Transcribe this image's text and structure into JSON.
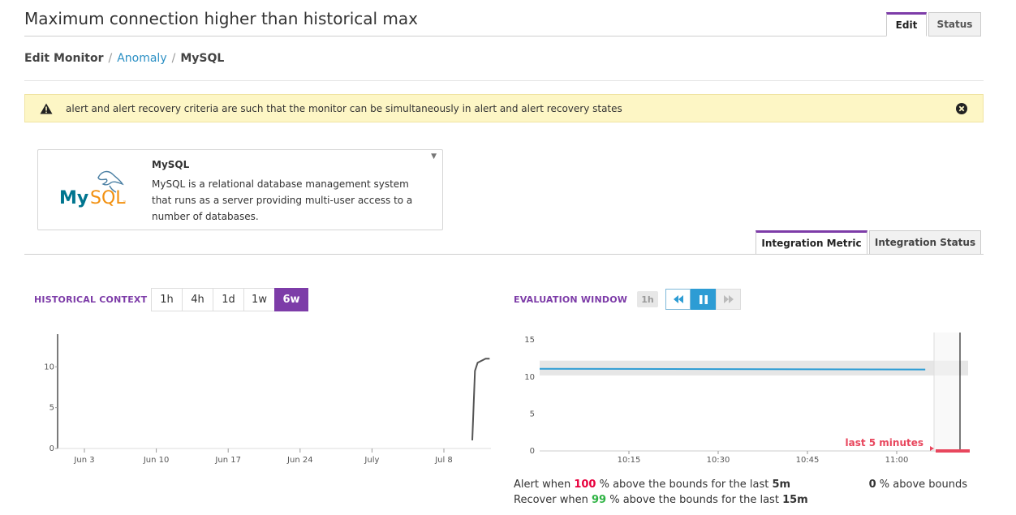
{
  "page": {
    "title": "Maximum connection higher than historical max",
    "tabs": [
      {
        "label": "Edit",
        "active": true
      },
      {
        "label": "Status",
        "active": false
      }
    ]
  },
  "breadcrumb": {
    "root": "Edit Monitor",
    "sep": "/",
    "type": "Anomaly",
    "current": "MySQL"
  },
  "warning": {
    "icon": "warning-icon",
    "text": "alert and alert recovery criteria are such that the monitor can be simultaneously in alert and alert recovery states",
    "close_icon": "close-circle-icon"
  },
  "integration": {
    "logo_text_my": "My",
    "logo_text_sql": "SQL",
    "logo_tm": "™",
    "name": "MySQL",
    "description": "MySQL is a relational database management system that runs as a server providing multi-user access to a number of databases.",
    "tabs": [
      {
        "label": "Integration Metric",
        "active": true
      },
      {
        "label": "Integration Status",
        "active": false
      }
    ]
  },
  "historical": {
    "label": "HISTORICAL CONTEXT",
    "ranges": [
      {
        "label": "1h",
        "active": false
      },
      {
        "label": "4h",
        "active": false
      },
      {
        "label": "1d",
        "active": false
      },
      {
        "label": "1w",
        "active": false
      },
      {
        "label": "6w",
        "active": true
      }
    ]
  },
  "evaluation": {
    "label": "EVALUATION WINDOW",
    "window": "1h",
    "controls": [
      "rewind-icon",
      "pause-icon",
      "fast-forward-icon"
    ]
  },
  "colors": {
    "accent": "#7d3ca8",
    "series": "#2d9cd4",
    "alert": "#e8465d",
    "band": "#e6e6e6"
  },
  "chart_data": [
    {
      "type": "line",
      "name": "historical-context",
      "x_ticks": [
        "Jun 3",
        "Jun 10",
        "Jun 17",
        "Jun 24",
        "July",
        "Jul 8"
      ],
      "y_ticks": [
        0,
        5,
        10
      ],
      "ylim": [
        0,
        14
      ],
      "series": [
        {
          "x": [
            6.22,
            6.26,
            6.3,
            6.42,
            6.48
          ],
          "y": [
            1,
            9.5,
            10.5,
            11,
            11
          ]
        }
      ],
      "grid": false
    },
    {
      "type": "line",
      "name": "evaluation-window",
      "x_ticks": [
        "10:15",
        "10:30",
        "10:45",
        "11:00"
      ],
      "y_ticks": [
        0,
        5,
        10,
        15
      ],
      "ylim": [
        0,
        16
      ],
      "bounds": [
        10.2,
        12.2
      ],
      "series": [
        {
          "x": [
            10.0,
            11.08
          ],
          "y": [
            11.1,
            11.0
          ]
        }
      ],
      "annotation": "last 5 minutes",
      "grid": false
    }
  ],
  "criteria": {
    "alert_prefix": "Alert when",
    "alert_pct": "100",
    "alert_mid": "% above the bounds for the last",
    "alert_window": "5m",
    "recover_prefix": "Recover when",
    "recover_pct": "99",
    "recover_mid": "% above the bounds for the last",
    "recover_window": "15m",
    "current_pct": "0",
    "current_suffix": "% above bounds"
  }
}
